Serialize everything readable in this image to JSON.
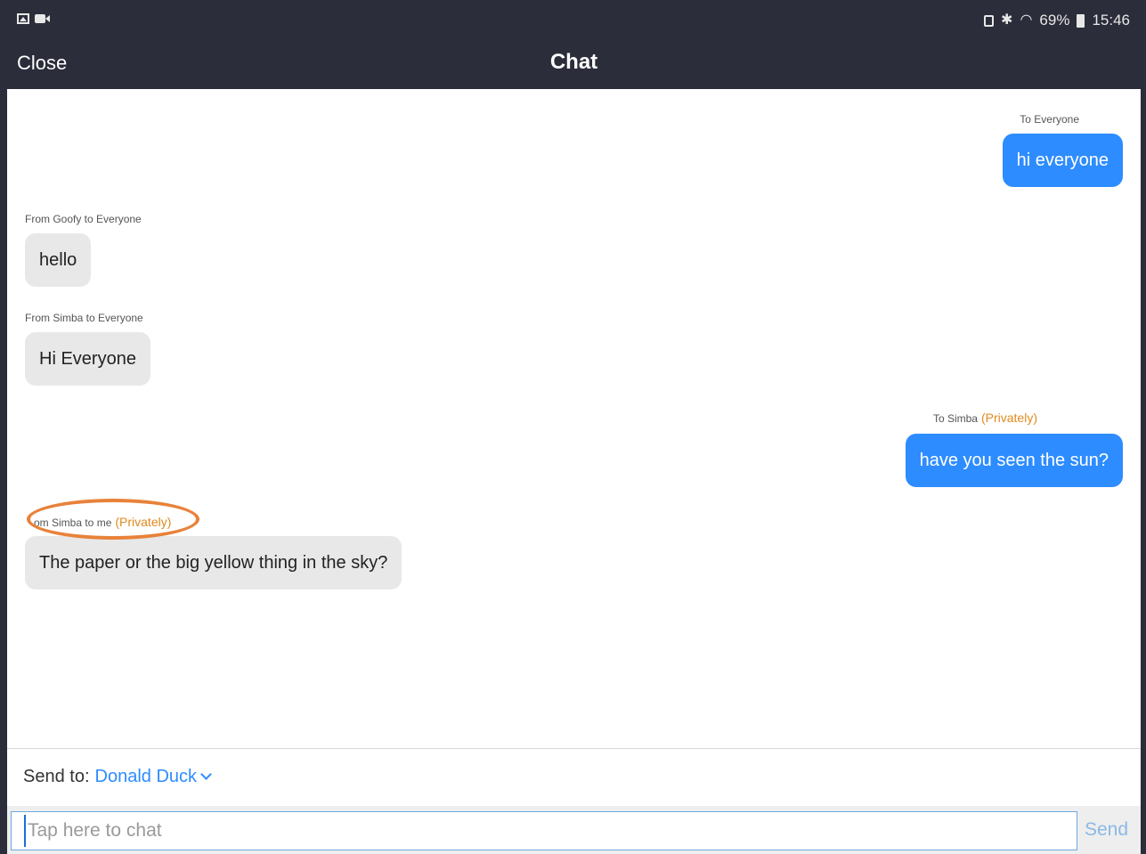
{
  "status_bar": {
    "left_icons": [
      "gallery-icon",
      "video-icon"
    ],
    "right_icons": [
      "lock-icon",
      "bluetooth-icon",
      "wifi-icon",
      "battery-icon"
    ],
    "battery_text": "69%",
    "time": "15:46"
  },
  "header": {
    "close_label": "Close",
    "title": "Chat"
  },
  "messages": [
    {
      "direction": "out",
      "meta": "To Everyone",
      "private_tag": "",
      "text": "hi everyone"
    },
    {
      "direction": "in",
      "meta": "From Goofy to Everyone",
      "private_tag": "",
      "text": "hello"
    },
    {
      "direction": "in",
      "meta": "From Simba to Everyone",
      "private_tag": "",
      "text": "Hi Everyone"
    },
    {
      "direction": "out",
      "meta": "To Simba",
      "private_tag": "(Privately)",
      "text": "have you seen the sun?"
    },
    {
      "direction": "in",
      "meta": "om Simba to me",
      "private_tag": "(Privately)",
      "text": "The paper or the big yellow thing in the sky?"
    }
  ],
  "send_to": {
    "label": "Send to:",
    "recipient": "Donald Duck"
  },
  "composer": {
    "placeholder": "Tap here to chat",
    "send_label": "Send"
  },
  "colors": {
    "bar": "#2b2d3a",
    "accent": "#2d8cff",
    "private": "#e08a1e",
    "highlight_ring": "#e8823a"
  }
}
